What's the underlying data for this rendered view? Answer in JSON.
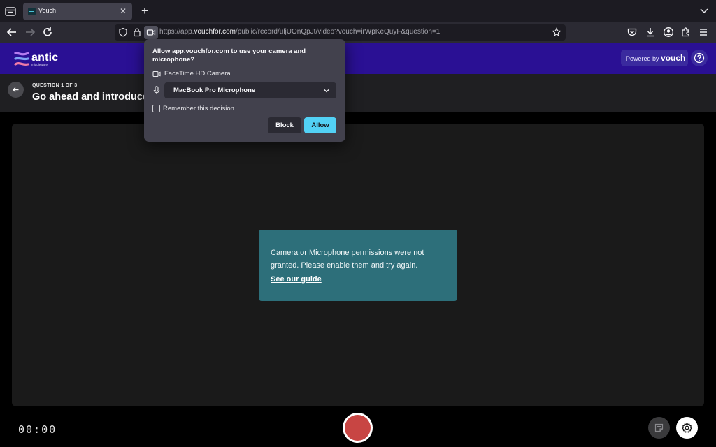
{
  "browser": {
    "tab": {
      "title": "Vouch",
      "close_glyph": "✕"
    },
    "new_tab_glyph": "+",
    "url": {
      "prefix": "https://app.",
      "domain": "vouchfor.com",
      "rest": "/public/record/uljUOnQpJt/video?vouch=irWpKeQuyF&question=1"
    }
  },
  "app": {
    "logo": {
      "text": "antic",
      "subtext": "middleware"
    },
    "powered_by": {
      "prefix": "Powered by",
      "brand": "vouch"
    }
  },
  "question": {
    "label": "QUESTION 1 OF 3",
    "title": "Go ahead and introduce y"
  },
  "error": {
    "message": "Camera or Microphone permissions were not granted. Please enable them and try again.",
    "link": "See our guide"
  },
  "recorder": {
    "timer": "00:00"
  },
  "permission_popup": {
    "title": "Allow app.vouchfor.com to use your camera and microphone?",
    "camera": "FaceTime HD Camera",
    "microphone": "MacBook Pro Microphone",
    "remember": "Remember this decision",
    "block": "Block",
    "allow": "Allow"
  },
  "colors": {
    "header": "#2a1094",
    "error_box": "#2d6f7a",
    "allow_button": "#52d1f5",
    "record_button": "#c84543"
  }
}
